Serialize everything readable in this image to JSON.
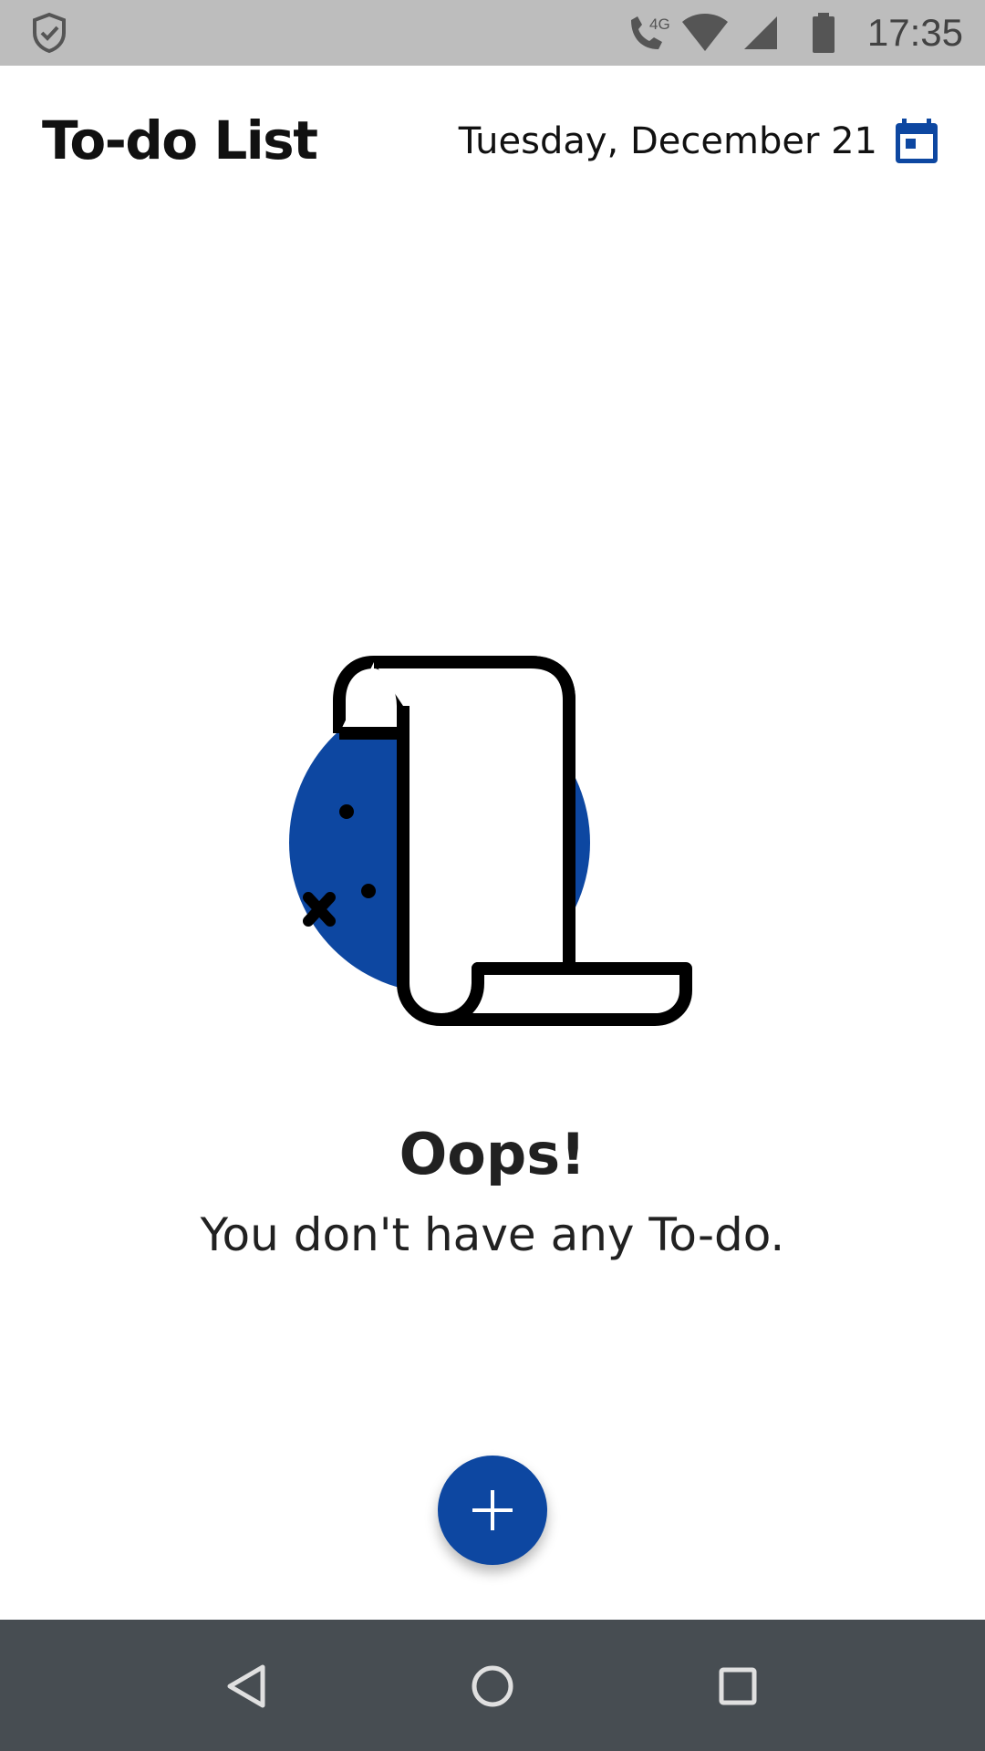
{
  "status_bar": {
    "time": "17:35",
    "network_label": "4G",
    "icons": [
      "shield-check-icon",
      "wifi-call-icon",
      "wifi-icon",
      "cell-signal-icon",
      "battery-icon"
    ]
  },
  "header": {
    "title": "To-do List",
    "date": "Tuesday, December 21",
    "calendar_icon": "calendar-icon"
  },
  "empty_state": {
    "illustration": "scroll-illustration",
    "title": "Oops!",
    "message": "You don't have any To-do."
  },
  "fab": {
    "icon": "plus-icon"
  },
  "nav_bar": {
    "icons": [
      "back-icon",
      "home-icon",
      "recents-icon"
    ]
  },
  "colors": {
    "accent": "#0d47a1",
    "status_bar": "#bdbdbd",
    "nav_bar": "#474d52",
    "text": "#111111"
  }
}
